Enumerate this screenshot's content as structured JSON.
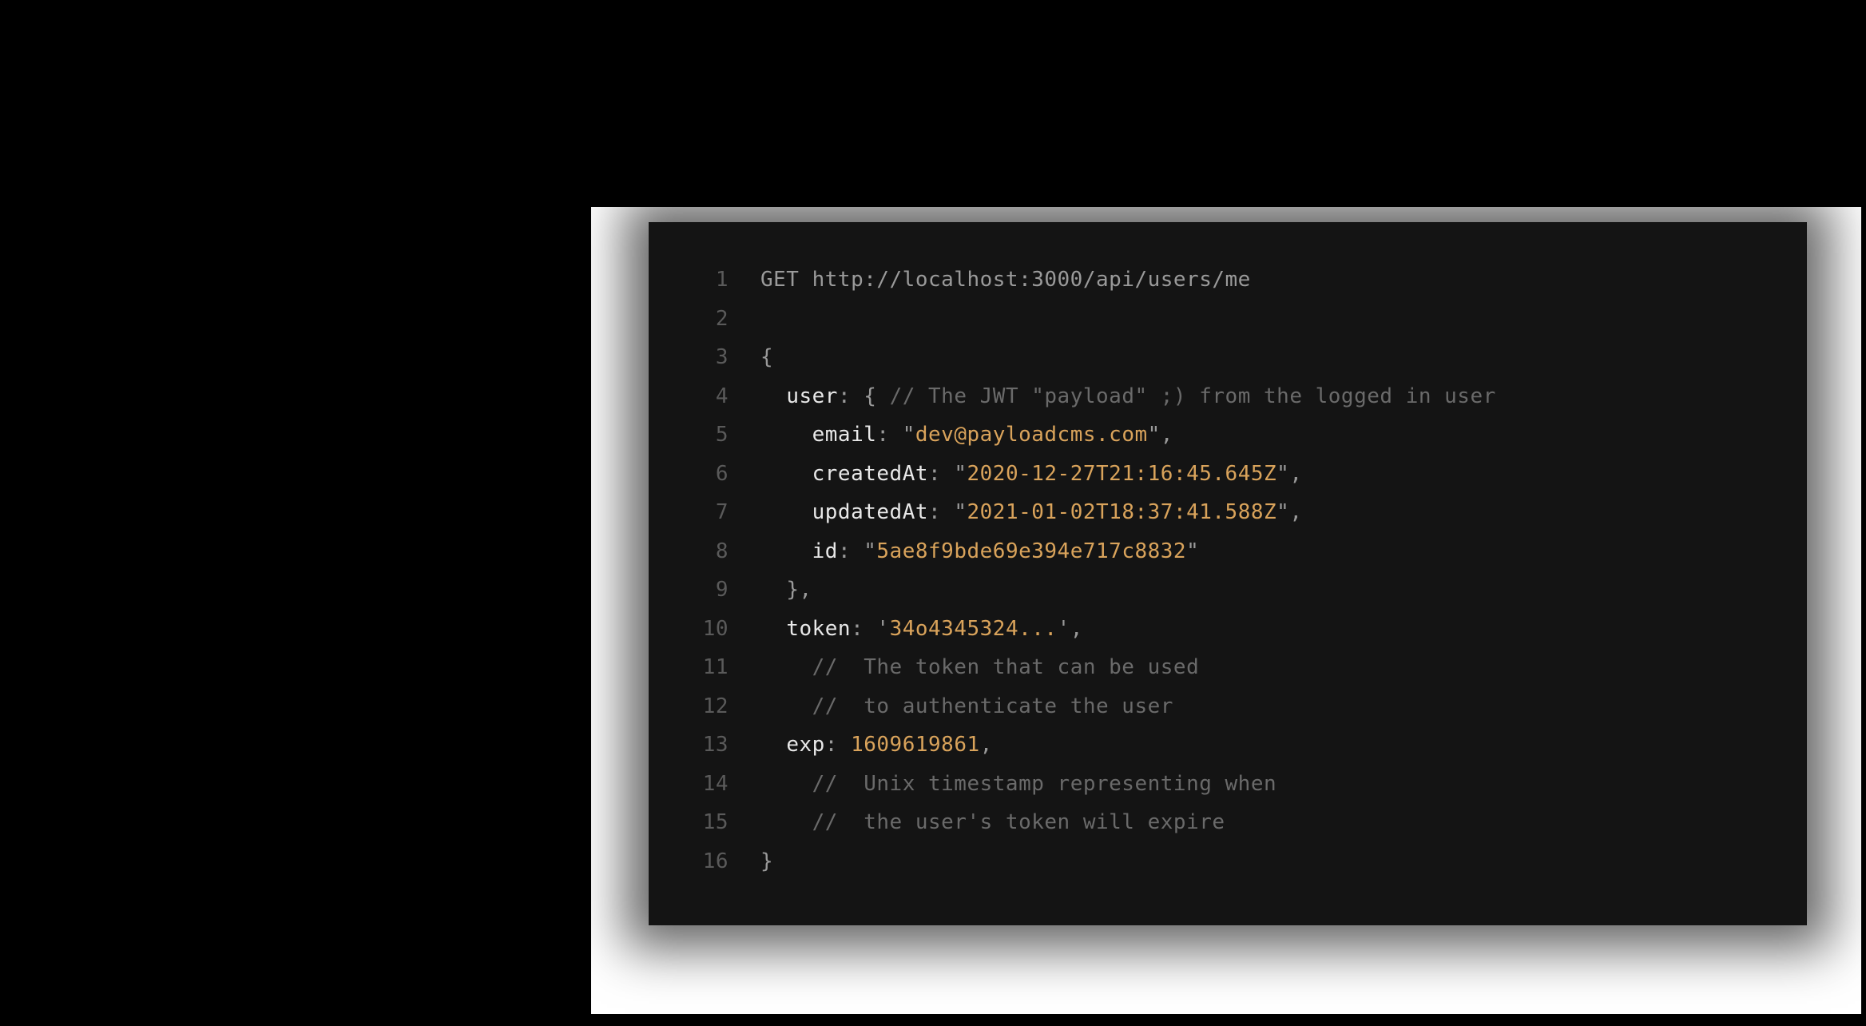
{
  "code": {
    "lines": [
      {
        "num": "1",
        "tokens": [
          {
            "cls": "tok-plain",
            "text": "GET http://localhost:3000/api/users/me"
          }
        ]
      },
      {
        "num": "2",
        "tokens": [
          {
            "cls": "tok-plain",
            "text": ""
          }
        ]
      },
      {
        "num": "3",
        "tokens": [
          {
            "cls": "tok-punct",
            "text": "{"
          }
        ]
      },
      {
        "num": "4",
        "tokens": [
          {
            "cls": "tok-plain",
            "text": "  "
          },
          {
            "cls": "tok-key",
            "text": "user"
          },
          {
            "cls": "tok-punct",
            "text": ": { "
          },
          {
            "cls": "tok-comment",
            "text": "// The JWT \"payload\" ;) from the logged in user"
          }
        ]
      },
      {
        "num": "5",
        "tokens": [
          {
            "cls": "tok-plain",
            "text": "    "
          },
          {
            "cls": "tok-key",
            "text": "email"
          },
          {
            "cls": "tok-punct",
            "text": ": \""
          },
          {
            "cls": "tok-string",
            "text": "dev@payloadcms.com"
          },
          {
            "cls": "tok-punct",
            "text": "\","
          }
        ]
      },
      {
        "num": "6",
        "tokens": [
          {
            "cls": "tok-plain",
            "text": "    "
          },
          {
            "cls": "tok-key",
            "text": "createdAt"
          },
          {
            "cls": "tok-punct",
            "text": ": \""
          },
          {
            "cls": "tok-string",
            "text": "2020-12-27T21:16:45.645Z"
          },
          {
            "cls": "tok-punct",
            "text": "\","
          }
        ]
      },
      {
        "num": "7",
        "tokens": [
          {
            "cls": "tok-plain",
            "text": "    "
          },
          {
            "cls": "tok-key",
            "text": "updatedAt"
          },
          {
            "cls": "tok-punct",
            "text": ": \""
          },
          {
            "cls": "tok-string",
            "text": "2021-01-02T18:37:41.588Z"
          },
          {
            "cls": "tok-punct",
            "text": "\","
          }
        ]
      },
      {
        "num": "8",
        "tokens": [
          {
            "cls": "tok-plain",
            "text": "    "
          },
          {
            "cls": "tok-key",
            "text": "id"
          },
          {
            "cls": "tok-punct",
            "text": ": \""
          },
          {
            "cls": "tok-string",
            "text": "5ae8f9bde69e394e717c8832"
          },
          {
            "cls": "tok-punct",
            "text": "\""
          }
        ]
      },
      {
        "num": "9",
        "tokens": [
          {
            "cls": "tok-plain",
            "text": "  "
          },
          {
            "cls": "tok-punct",
            "text": "},"
          }
        ]
      },
      {
        "num": "10",
        "tokens": [
          {
            "cls": "tok-plain",
            "text": "  "
          },
          {
            "cls": "tok-key",
            "text": "token"
          },
          {
            "cls": "tok-punct",
            "text": ": '"
          },
          {
            "cls": "tok-string",
            "text": "34o4345324..."
          },
          {
            "cls": "tok-punct",
            "text": "',"
          }
        ]
      },
      {
        "num": "11",
        "tokens": [
          {
            "cls": "tok-plain",
            "text": "    "
          },
          {
            "cls": "tok-comment",
            "text": "//  The token that can be used"
          }
        ]
      },
      {
        "num": "12",
        "tokens": [
          {
            "cls": "tok-plain",
            "text": "    "
          },
          {
            "cls": "tok-comment",
            "text": "//  to authenticate the user"
          }
        ]
      },
      {
        "num": "13",
        "tokens": [
          {
            "cls": "tok-plain",
            "text": "  "
          },
          {
            "cls": "tok-key",
            "text": "exp"
          },
          {
            "cls": "tok-punct",
            "text": ": "
          },
          {
            "cls": "tok-number",
            "text": "1609619861"
          },
          {
            "cls": "tok-punct",
            "text": ","
          }
        ]
      },
      {
        "num": "14",
        "tokens": [
          {
            "cls": "tok-plain",
            "text": "    "
          },
          {
            "cls": "tok-comment",
            "text": "//  Unix timestamp representing when"
          }
        ]
      },
      {
        "num": "15",
        "tokens": [
          {
            "cls": "tok-plain",
            "text": "    "
          },
          {
            "cls": "tok-comment",
            "text": "//  the user's token will expire"
          }
        ]
      },
      {
        "num": "16",
        "tokens": [
          {
            "cls": "tok-punct",
            "text": "}"
          }
        ]
      }
    ]
  }
}
